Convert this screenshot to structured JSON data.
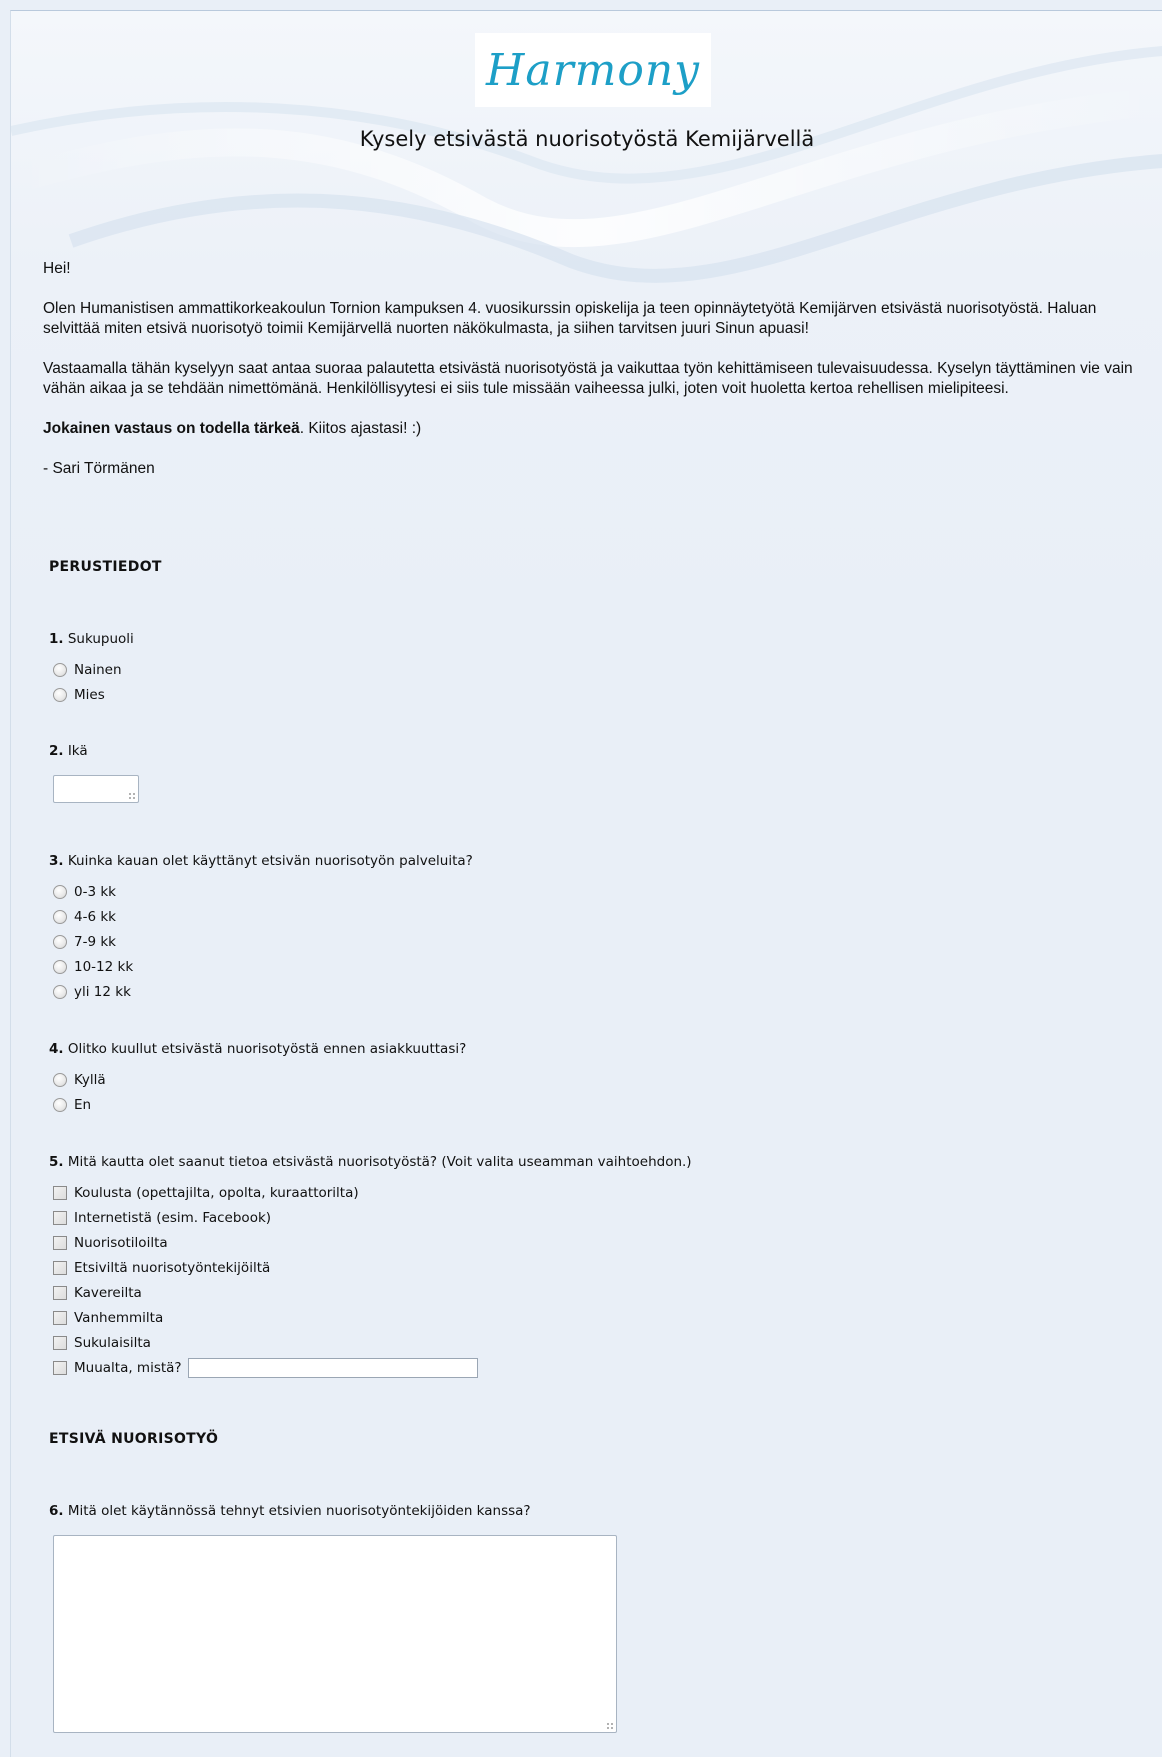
{
  "header": {
    "logo_text": "Harmony",
    "title": "Kysely etsivästä nuorisotyöstä Kemijärvellä"
  },
  "intro": {
    "greeting": "Hei!",
    "paragraph1": "Olen Humanistisen ammattikorkeakoulun Tornion kampuksen 4. vuosikurssin opiskelija ja teen opinnäytetyötä Kemijärven etsivästä nuorisotyöstä. Haluan selvittää miten etsivä nuorisotyö toimii Kemijärvellä nuorten näkökulmasta, ja siihen tarvitsen juuri Sinun apuasi!",
    "paragraph2": "Vastaamalla tähän kyselyyn saat antaa suoraa palautetta etsivästä nuorisotyöstä ja vaikuttaa työn kehittämiseen tulevaisuudessa. Kyselyn täyttäminen vie vain vähän aikaa ja se tehdään nimettömänä. Henkilöllisyytesi ei siis tule missään vaiheessa julki, joten voit huoletta kertoa rehellisen mielipiteesi.",
    "emphasis": "Jokainen vastaus on todella tärkeä",
    "thanks": ". Kiitos ajastasi! :)",
    "signature": "- Sari Törmänen"
  },
  "sections": {
    "basic_info": "PERUSTIEDOT",
    "outreach": "ETSIVÄ NUORISOTYÖ"
  },
  "questions": {
    "q1": {
      "num": "1.",
      "text": "Sukupuoli",
      "options": [
        "Nainen",
        "Mies"
      ]
    },
    "q2": {
      "num": "2.",
      "text": "Ikä",
      "value": ""
    },
    "q3": {
      "num": "3.",
      "text": "Kuinka kauan olet käyttänyt etsivän nuorisotyön palveluita?",
      "options": [
        "0-3 kk",
        "4-6 kk",
        "7-9 kk",
        "10-12 kk",
        "yli 12 kk"
      ]
    },
    "q4": {
      "num": "4.",
      "text": "Olitko kuullut etsivästä nuorisotyöstä ennen asiakkuuttasi?",
      "options": [
        "Kyllä",
        "En"
      ]
    },
    "q5": {
      "num": "5.",
      "text": "Mitä kautta olet saanut tietoa etsivästä nuorisotyöstä? (Voit valita useamman vaihtoehdon.)",
      "options": [
        "Koulusta (opettajilta, opolta, kuraattorilta)",
        "Internetistä (esim. Facebook)",
        "Nuorisotiloilta",
        "Etsiviltä nuorisotyöntekijöiltä",
        "Kavereilta",
        "Vanhemmilta",
        "Sukulaisilta",
        "Muualta, mistä?"
      ]
    },
    "q6": {
      "num": "6.",
      "text": "Mitä olet käytännössä tehnyt etsivien nuorisotyöntekijöiden kanssa?",
      "value": ""
    }
  }
}
